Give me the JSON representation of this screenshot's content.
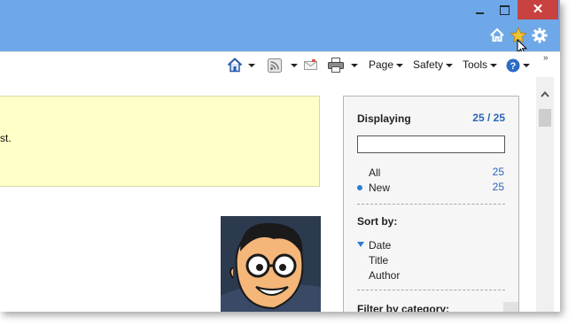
{
  "window": {
    "minimize_icon": "minimize-icon",
    "maximize_icon": "maximize-icon",
    "close_glyph": "✕",
    "close_color": "#c7423f",
    "titlebar_color": "#6ea8e8"
  },
  "toolbar_icons": [
    "home-icon",
    "star-icon",
    "gear-icon"
  ],
  "command_bar": {
    "home": "home-icon",
    "feeds": "rss-icon",
    "mail": "mail-icon",
    "print": "print-icon",
    "page_label": "Page",
    "safety_label": "Safety",
    "tools_label": "Tools",
    "help": "help-icon",
    "overflow": "»"
  },
  "content": {
    "notice_text": "st."
  },
  "panel": {
    "title": "Displaying",
    "count": "25 / 25",
    "search_value": "",
    "filters": [
      {
        "label": "All",
        "count": "25"
      },
      {
        "label": "New",
        "count": "25"
      }
    ],
    "sort_heading": "Sort by:",
    "sort_options": [
      "Date",
      "Title",
      "Author"
    ],
    "filter_heading": "Filter by category:"
  },
  "colors": {
    "link_blue": "#2a66b8",
    "notice_bg": "#ffffc8"
  }
}
